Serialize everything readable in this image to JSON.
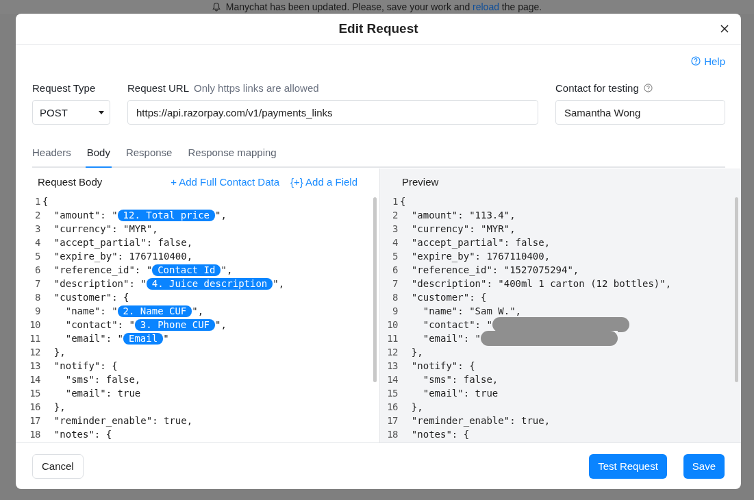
{
  "banner": {
    "text_before": "Manychat has been updated. Please, save your work and",
    "link": "reload",
    "text_after": "the page."
  },
  "dialog": {
    "title": "Edit Request",
    "help": "Help"
  },
  "request_type": {
    "label": "Request Type",
    "value": "POST"
  },
  "request_url": {
    "label": "Request URL",
    "hint": "Only https links are allowed",
    "value": "https://api.razorpay.com/v1/payments_links"
  },
  "contact_for_testing": {
    "label": "Contact for testing",
    "value": "Samantha Wong"
  },
  "tabs": [
    {
      "label": "Headers",
      "selected": false
    },
    {
      "label": "Body",
      "selected": true
    },
    {
      "label": "Response",
      "selected": false
    },
    {
      "label": "Response mapping",
      "selected": false
    }
  ],
  "request_body": {
    "title": "Request Body",
    "actions": [
      "+ Add Full Contact Data",
      "{+} Add a Field"
    ],
    "lines": [
      {
        "number": "1",
        "parts": [
          {
            "kind": "text",
            "text": "{"
          }
        ]
      },
      {
        "number": "2",
        "parts": [
          {
            "kind": "text",
            "text": "  \"amount\": \""
          },
          {
            "kind": "token",
            "text": "12. Total price"
          },
          {
            "kind": "text",
            "text": "\","
          }
        ]
      },
      {
        "number": "3",
        "parts": [
          {
            "kind": "text",
            "text": "  \"currency\": \"MYR\","
          }
        ]
      },
      {
        "number": "4",
        "parts": [
          {
            "kind": "text",
            "text": "  \"accept_partial\": false,"
          }
        ]
      },
      {
        "number": "5",
        "parts": [
          {
            "kind": "text",
            "text": "  \"expire_by\": 1767110400,"
          }
        ]
      },
      {
        "number": "6",
        "parts": [
          {
            "kind": "text",
            "text": "  \"reference_id\": \""
          },
          {
            "kind": "token",
            "text": "Contact Id"
          },
          {
            "kind": "text",
            "text": "\","
          }
        ]
      },
      {
        "number": "7",
        "parts": [
          {
            "kind": "text",
            "text": "  \"description\": \""
          },
          {
            "kind": "token",
            "text": "4. Juice description"
          },
          {
            "kind": "text",
            "text": "\","
          }
        ]
      },
      {
        "number": "8",
        "parts": [
          {
            "kind": "text",
            "text": "  \"customer\": {"
          }
        ]
      },
      {
        "number": "9",
        "parts": [
          {
            "kind": "text",
            "text": "    \"name\": \""
          },
          {
            "kind": "token",
            "text": "2. Name CUF"
          },
          {
            "kind": "text",
            "text": "\","
          }
        ]
      },
      {
        "number": "10",
        "parts": [
          {
            "kind": "text",
            "text": "    \"contact\": \""
          },
          {
            "kind": "token",
            "text": "3. Phone CUF"
          },
          {
            "kind": "text",
            "text": "\","
          }
        ]
      },
      {
        "number": "11",
        "parts": [
          {
            "kind": "text",
            "text": "    \"email\": \""
          },
          {
            "kind": "token",
            "text": "Email"
          },
          {
            "kind": "text",
            "text": "\""
          }
        ]
      },
      {
        "number": "12",
        "parts": [
          {
            "kind": "text",
            "text": "  },"
          }
        ]
      },
      {
        "number": "13",
        "parts": [
          {
            "kind": "text",
            "text": "  \"notify\": {"
          }
        ]
      },
      {
        "number": "14",
        "parts": [
          {
            "kind": "text",
            "text": "    \"sms\": false,"
          }
        ]
      },
      {
        "number": "15",
        "parts": [
          {
            "kind": "text",
            "text": "    \"email\": true"
          }
        ]
      },
      {
        "number": "16",
        "parts": [
          {
            "kind": "text",
            "text": "  },"
          }
        ]
      },
      {
        "number": "17",
        "parts": [
          {
            "kind": "text",
            "text": "  \"reminder_enable\": true,"
          }
        ]
      },
      {
        "number": "18",
        "parts": [
          {
            "kind": "text",
            "text": "  \"notes\": {"
          }
        ]
      }
    ]
  },
  "preview": {
    "title": "Preview",
    "lines": [
      {
        "number": "1",
        "parts": [
          {
            "kind": "text",
            "text": "{"
          }
        ]
      },
      {
        "number": "2",
        "parts": [
          {
            "kind": "text",
            "text": "  \"amount\": \"113.4\","
          }
        ]
      },
      {
        "number": "3",
        "parts": [
          {
            "kind": "text",
            "text": "  \"currency\": \"MYR\","
          }
        ]
      },
      {
        "number": "4",
        "parts": [
          {
            "kind": "text",
            "text": "  \"accept_partial\": false,"
          }
        ]
      },
      {
        "number": "5",
        "parts": [
          {
            "kind": "text",
            "text": "  \"expire_by\": 1767110400,"
          }
        ]
      },
      {
        "number": "6",
        "parts": [
          {
            "kind": "text",
            "text": "  \"reference_id\": \"1527075294\","
          }
        ]
      },
      {
        "number": "7",
        "parts": [
          {
            "kind": "text",
            "text": "  \"description\": \"400ml 1 carton (12 bottles)\","
          }
        ]
      },
      {
        "number": "8",
        "parts": [
          {
            "kind": "text",
            "text": "  \"customer\": {"
          }
        ]
      },
      {
        "number": "9",
        "parts": [
          {
            "kind": "text",
            "text": "    \"name\": \"Sam W.\","
          }
        ]
      },
      {
        "number": "10",
        "parts": [
          {
            "kind": "text",
            "text": "    \"contact\": \""
          },
          {
            "kind": "redacted"
          }
        ]
      },
      {
        "number": "11",
        "parts": [
          {
            "kind": "text",
            "text": "    \"email\": \""
          },
          {
            "kind": "redacted"
          }
        ]
      },
      {
        "number": "12",
        "parts": [
          {
            "kind": "text",
            "text": "  },"
          }
        ]
      },
      {
        "number": "13",
        "parts": [
          {
            "kind": "text",
            "text": "  \"notify\": {"
          }
        ]
      },
      {
        "number": "14",
        "parts": [
          {
            "kind": "text",
            "text": "    \"sms\": false,"
          }
        ]
      },
      {
        "number": "15",
        "parts": [
          {
            "kind": "text",
            "text": "    \"email\": true"
          }
        ]
      },
      {
        "number": "16",
        "parts": [
          {
            "kind": "text",
            "text": "  },"
          }
        ]
      },
      {
        "number": "17",
        "parts": [
          {
            "kind": "text",
            "text": "  \"reminder_enable\": true,"
          }
        ]
      },
      {
        "number": "18",
        "parts": [
          {
            "kind": "text",
            "text": "  \"notes\": {"
          }
        ]
      }
    ]
  },
  "footer": {
    "cancel": "Cancel",
    "test": "Test Request",
    "save": "Save"
  }
}
